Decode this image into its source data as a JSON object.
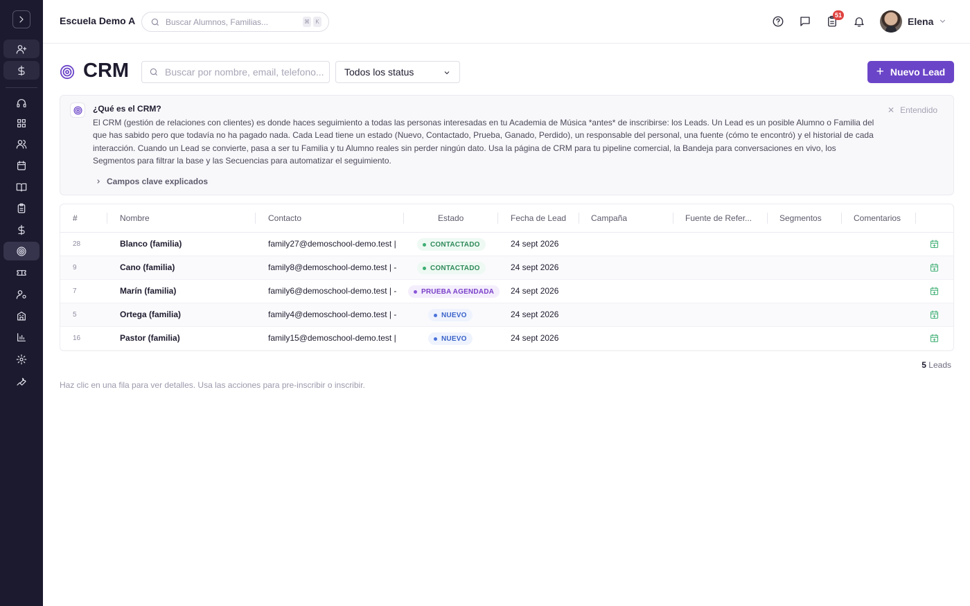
{
  "topbar": {
    "school_name": "Escuela Demo A",
    "search_placeholder": "Buscar Alumnos, Familias...",
    "kbd_1": "⌘",
    "kbd_2": "K",
    "notification_count": "51",
    "user_name": "Elena"
  },
  "sidebar": {
    "items": [
      "add-user",
      "dollar",
      "headset",
      "dashboard",
      "users",
      "calendar",
      "book",
      "clipboard",
      "dollar",
      "target",
      "ticket",
      "user-settings",
      "building",
      "chart",
      "gear",
      "wrench"
    ],
    "active": "target"
  },
  "page": {
    "title": "CRM",
    "search_placeholder": "Buscar por nombre, email, telefono...",
    "status_filter": "Todos los status",
    "new_lead_label": "Nuevo Lead"
  },
  "info": {
    "title": "¿Qué es el CRM?",
    "body": "El CRM (gestión de relaciones con clientes) es donde haces seguimiento a todas las personas interesadas en tu Academia de Música *antes* de inscribirse: los Leads. Un Lead es un posible Alumno o Familia del que has sabido pero que todavía no ha pagado nada. Cada Lead tiene un estado (Nuevo, Contactado, Prueba, Ganado, Perdido), un responsable del personal, una fuente (cómo te encontró) y el historial de cada interacción. Cuando un Lead se convierte, pasa a ser tu Familia y tu Alumno reales sin perder ningún dato. Usa la página de CRM para tu pipeline comercial, la Bandeja para conversaciones en vivo, los Segmentos para filtrar la base y las Secuencias para automatizar el seguimiento.",
    "more_label": "Campos clave explicados",
    "dismiss_label": "Entendido"
  },
  "table": {
    "headers": {
      "num": "#",
      "name": "Nombre",
      "contact": "Contacto",
      "status": "Estado",
      "date": "Fecha de Lead",
      "campaign": "Campaña",
      "source": "Fuente de Refer...",
      "segments": "Segmentos",
      "comments": "Comentarios"
    },
    "rows": [
      {
        "num": "28",
        "name": "Blanco (familia)",
        "contact": "family27@demoschool-demo.test |",
        "status": "CONTACTADO",
        "date": "24 sept 2026"
      },
      {
        "num": "9",
        "name": "Cano (familia)",
        "contact": "family8@demoschool-demo.test | -",
        "status": "CONTACTADO",
        "date": "24 sept 2026"
      },
      {
        "num": "7",
        "name": "Marín (familia)",
        "contact": "family6@demoschool-demo.test | -",
        "status": "PRUEBA AGENDADA",
        "date": "24 sept 2026"
      },
      {
        "num": "5",
        "name": "Ortega (familia)",
        "contact": "family4@demoschool-demo.test | -",
        "status": "NUEVO",
        "date": "24 sept 2026"
      },
      {
        "num": "16",
        "name": "Pastor (familia)",
        "contact": "family15@demoschool-demo.test |",
        "status": "NUEVO",
        "date": "24 sept 2026"
      }
    ]
  },
  "footer": {
    "count": "5",
    "count_label": "Leads",
    "hint": "Haz clic en una fila para ver detalles. Usa las acciones para pre-inscribir o inscribir."
  },
  "colors": {
    "sidebar": "#1b1a2e",
    "accent": "#6b45c8",
    "contactado": "#2f8a5a",
    "prueba": "#7a3fc9",
    "nuevo": "#3a62c9",
    "badge": "#e0423f"
  }
}
